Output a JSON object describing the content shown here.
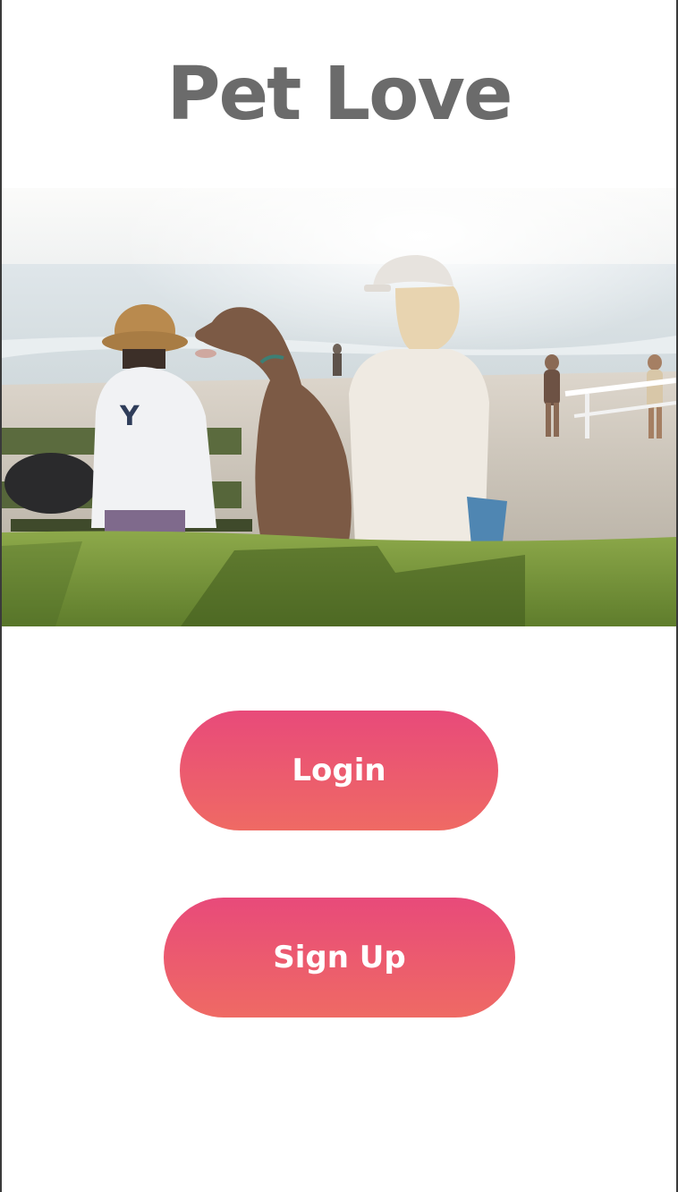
{
  "app": {
    "title": "Pet Love"
  },
  "hero": {
    "image_subject": "people-and-dog-on-beach-photo"
  },
  "actions": {
    "login_label": "Login",
    "signup_label": "Sign Up"
  },
  "colors": {
    "title": "#6b6b6b",
    "button_top": "#e84a7a",
    "button_bottom": "#ef6a64",
    "button_text": "#ffffff"
  }
}
